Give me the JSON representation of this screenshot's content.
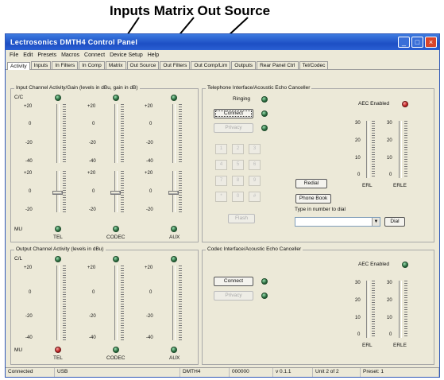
{
  "annotation": {
    "text": "Inputs Matrix Out Source"
  },
  "window": {
    "title": "Lectrosonics DMTH4 Control Panel"
  },
  "menu": [
    "File",
    "Edit",
    "Presets",
    "Macros",
    "Connect",
    "Device Setup",
    "Help"
  ],
  "tabs": [
    "Activity",
    "Inputs",
    "In Filters",
    "In Comp",
    "Matrix",
    "Out Source",
    "Out Filters",
    "Out Comp/Lim",
    "Outputs",
    "Rear Panel Ctrl",
    "Tel/Codec"
  ],
  "active_tab": "Activity",
  "input_group": {
    "title": "Input Channel Activity/Gain (levels in dBu, gain in dB)",
    "cc_label": "C/C",
    "mu_label": "MU",
    "channels": [
      "TEL",
      "CODEC",
      "AUX"
    ],
    "meter_ticks": [
      "+20",
      "0",
      "-20",
      "-40"
    ],
    "gain_ticks": [
      "+20",
      "0",
      "-20"
    ]
  },
  "output_group": {
    "title": "Output Channel Activity (levels in dBu)",
    "cl_label": "C/L",
    "mu_label": "MU",
    "channels": [
      "TEL",
      "CODEC",
      "AUX"
    ],
    "meter_ticks": [
      "+20",
      "0",
      "-20",
      "-40"
    ]
  },
  "tel_group": {
    "title": "Telephone Interface/Acoustic Echo Canceller",
    "ringing_label": "Ringing",
    "connect_label": "Connect",
    "privacy_label": "Privacy",
    "aec_label": "AEC Enabled",
    "keypad": [
      "1",
      "2",
      "3",
      "4",
      "5",
      "6",
      "7",
      "8",
      "9",
      "*",
      "0",
      "#"
    ],
    "flash_label": "Flash",
    "redial_label": "Redial",
    "phonebook_label": "Phone Book",
    "dial_prompt": "Type in number to dial",
    "dial_value": "",
    "dial_label": "Dial",
    "erl_label": "ERL",
    "erle_label": "ERLE",
    "erl_ticks": [
      "30",
      "20",
      "10",
      "0"
    ],
    "erle_ticks": [
      "30",
      "20",
      "10",
      "0"
    ]
  },
  "codec_group": {
    "title": "Codec Interface/Acoustic Echo Canceller",
    "connect_label": "Connect",
    "privacy_label": "Privacy",
    "aec_label": "AEC Enabled",
    "erl_label": "ERL",
    "erle_label": "ERLE",
    "erl_ticks": [
      "30",
      "20",
      "10",
      "0"
    ],
    "erle_ticks": [
      "30",
      "20",
      "10",
      "0"
    ]
  },
  "status": {
    "connection": "Connected",
    "port": "USB",
    "device": "DMTH4",
    "serial": "000000",
    "version": "v 0.1.1",
    "unit": "Unit 2 of 2",
    "preset": "Preset: 1"
  },
  "colors": {
    "title_bar": "#1d4fc4",
    "led_green": "#2a6a3e",
    "led_red": "#c02020",
    "window_bg": "#ece9d8"
  }
}
